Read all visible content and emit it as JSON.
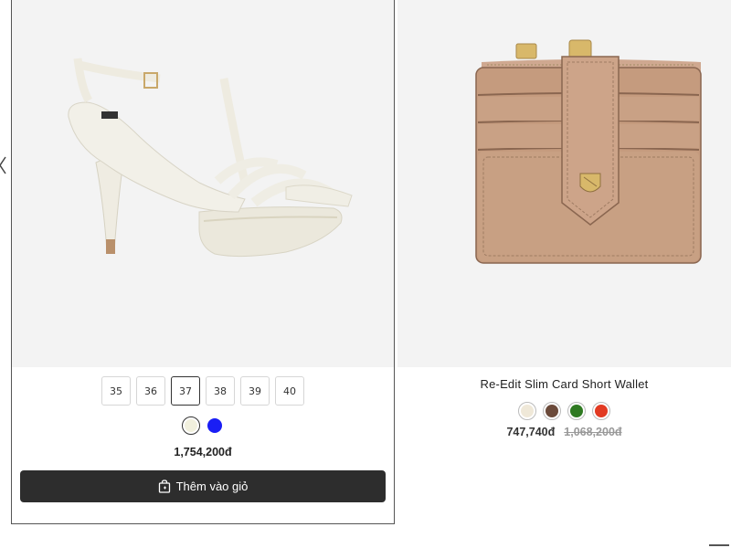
{
  "products": [
    {
      "image_alt": "White platform sandal",
      "sizes": [
        {
          "label": "35",
          "selected": false
        },
        {
          "label": "36",
          "selected": false
        },
        {
          "label": "37",
          "selected": true
        },
        {
          "label": "38",
          "selected": false
        },
        {
          "label": "39",
          "selected": false
        },
        {
          "label": "40",
          "selected": false
        }
      ],
      "colors": [
        {
          "hex": "#f1f0dd",
          "active": true
        },
        {
          "hex": "#1a1ef5",
          "active": false
        }
      ],
      "price": "1,754,200đ",
      "add_to_cart_label": "Thêm vào giỏ"
    },
    {
      "image_alt": "Re-Edit Slim Card Short Wallet",
      "name": "Re-Edit Slim Card Short Wallet",
      "colors": [
        {
          "hex": "#efe8d8",
          "active": true
        },
        {
          "hex": "#6b4a3a",
          "active": false
        },
        {
          "hex": "#2f7a22",
          "active": false
        },
        {
          "hex": "#e23a22",
          "active": false
        }
      ],
      "sale_price": "747,740đ",
      "original_price": "1,068,200đ"
    }
  ],
  "icons": {
    "prev": "chevron-left-icon",
    "cart": "shopping-bag-icon"
  }
}
